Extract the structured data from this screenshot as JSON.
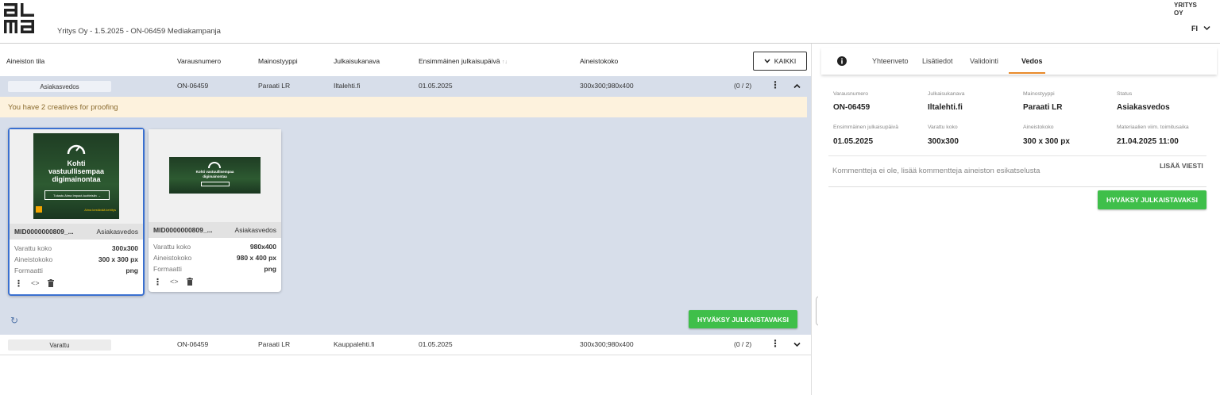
{
  "header": {
    "title": "Yritys Oy - 1.5.2025 - ON-06459 Mediakampanja",
    "company_line1": "YRITYS",
    "company_line2": "OY",
    "language": "FI"
  },
  "table": {
    "columns": [
      "Aineiston tila",
      "Varausnumero",
      "Mainostyyppi",
      "Julkaisukanava",
      "Ensimmäinen julkaisupäivä",
      "Aineistokoko"
    ],
    "sort_indicator": "↑↓",
    "filter_label": "KAIKKI",
    "rows": [
      {
        "status": "Asiakasvedos",
        "varausnumero": "ON-06459",
        "mainostyyppi": "Paraati LR",
        "kanava": "Iltalehti.fi",
        "paiva": "01.05.2025",
        "koko": "300x300;980x400",
        "count": "(0 / 2)"
      },
      {
        "status": "Varattu",
        "varausnumero": "ON-06459",
        "mainostyyppi": "Paraati LR",
        "kanava": "Kauppalehti.fi",
        "paiva": "01.05.2025",
        "koko": "300x300;980x400",
        "count": "(0 / 2)"
      }
    ],
    "notice": "You have 2 creatives for proofing",
    "approve_label": "HYVÄKSY JULKAISTAVAKSI"
  },
  "creatives": [
    {
      "id": "MID0000000809_...",
      "status": "Asiakasvedos",
      "rows": [
        {
          "k": "Varattu koko",
          "v": "300x300"
        },
        {
          "k": "Aineistokoko",
          "v": "300 x 300 px"
        },
        {
          "k": "Formaatti",
          "v": "png"
        }
      ],
      "ad_line1": "Kohti",
      "ad_line2": "vastuullisempaa",
      "ad_line3": "digimainontaa",
      "ad_cta": "Tutustu Alma Impact-tuotteisiin →",
      "ad_footer": "Alma kestävää kehitys"
    },
    {
      "id": "MID0000000809_...",
      "status": "Asiakasvedos",
      "rows": [
        {
          "k": "Varattu koko",
          "v": "980x400"
        },
        {
          "k": "Aineistokoko",
          "v": "980 x 400 px"
        },
        {
          "k": "Formaatti",
          "v": "png"
        }
      ],
      "ad_line1": "Kohti vastuullisempaa",
      "ad_line2": "digimainontaa"
    }
  ],
  "details": {
    "tabs": [
      "Yhteenveto",
      "Lisätiedot",
      "Validointi",
      "Vedos"
    ],
    "active_tab": "Vedos",
    "fields": [
      {
        "label": "Varausnumero",
        "value": "ON-06459"
      },
      {
        "label": "Julkaisukanava",
        "value": "Iltalehti.fi"
      },
      {
        "label": "Mainostyyppi",
        "value": "Paraati LR"
      },
      {
        "label": "Status",
        "value": "Asiakasvedos"
      },
      {
        "label": "Ensimmäinen julkaisupäivä",
        "value": "01.05.2025"
      },
      {
        "label": "Varattu koko",
        "value": "300x300"
      },
      {
        "label": "Aineistokoko",
        "value": "300 x 300 px"
      },
      {
        "label": "Materiaalien viim. toimitusaika",
        "value": "21.04.2025 11:00"
      }
    ],
    "comments_text": "Kommentteja ei ole, lisää kommentteja aineiston esikatselusta",
    "add_message": "LISÄÄ VIESTI",
    "approve_label": "HYVÄKSY JULKAISTAVAKSI"
  },
  "colors": {
    "accent_green": "#3fbf4a",
    "selected_border": "#3a70d0",
    "active_tab": "#e88a2a",
    "notice_bg": "#fdf2dd"
  }
}
